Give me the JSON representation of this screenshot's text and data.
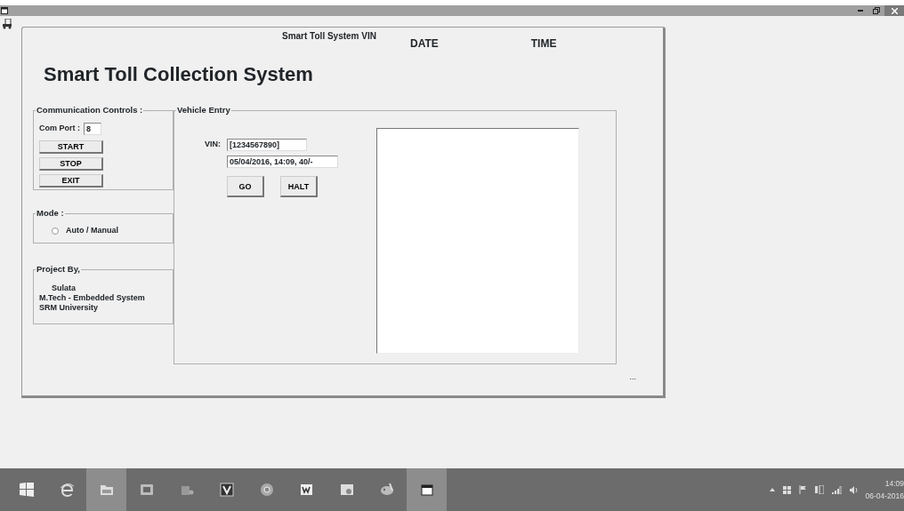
{
  "form": {
    "caption": "Smart Toll System VIN",
    "date_label": "DATE",
    "time_label": "TIME",
    "title": "Smart Toll Collection System",
    "communication": {
      "legend": "Communication Controls :",
      "com_port_label": "Com Port :",
      "com_port_value": "8",
      "buttons": [
        "START",
        "STOP",
        "EXIT"
      ]
    },
    "mode": {
      "legend": "Mode :",
      "options": [
        {
          "label": "Auto / Manual",
          "selected": false
        }
      ]
    },
    "project": {
      "legend": "Project By,",
      "lines": [
        "Sulata",
        "M.Tech - Embedded System",
        "SRM University"
      ]
    },
    "vehicle_entry": {
      "legend": "Vehicle Entry",
      "vin_label": "VIN:",
      "vin_value": "[1234567890]",
      "details_value": "05/04/2016, 14:09, 40/-",
      "buttons": [
        "GO",
        "HALT"
      ]
    },
    "footer_text": "..."
  },
  "taskbar": {
    "apps": [
      {
        "kind": "start",
        "selected": false
      },
      {
        "kind": "browser",
        "selected": false
      },
      {
        "kind": "folder",
        "selected": true
      },
      {
        "kind": "photos",
        "selected": false
      },
      {
        "kind": "media",
        "selected": false
      },
      {
        "kind": "editor",
        "selected": false
      },
      {
        "kind": "globe",
        "selected": false
      },
      {
        "kind": "writer",
        "selected": false
      },
      {
        "kind": "slides",
        "selected": false
      },
      {
        "kind": "paint",
        "selected": false
      },
      {
        "kind": "window",
        "selected": true
      }
    ],
    "clock": {
      "time": "14:09",
      "date": "06-04-2016"
    }
  }
}
